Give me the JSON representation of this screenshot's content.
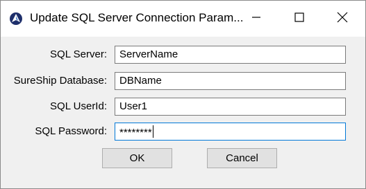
{
  "window": {
    "title": "Update SQL Server Connection Param...",
    "icon": "sureship-logo-icon",
    "controls": {
      "minimize": "minimize-icon",
      "maximize": "maximize-icon",
      "close": "close-icon"
    }
  },
  "form": {
    "server": {
      "label": "SQL Server:",
      "value": "ServerName"
    },
    "database": {
      "label": "SureShip Database:",
      "value": "DBName"
    },
    "userid": {
      "label": "SQL UserId:",
      "value": "User1"
    },
    "password": {
      "label": "SQL Password:",
      "value": "********"
    }
  },
  "buttons": {
    "ok_label": "OK",
    "cancel_label": "Cancel"
  },
  "colors": {
    "focus_border": "#0078d7",
    "dialog_bg": "#f0f0f0",
    "button_bg": "#e1e1e1"
  }
}
